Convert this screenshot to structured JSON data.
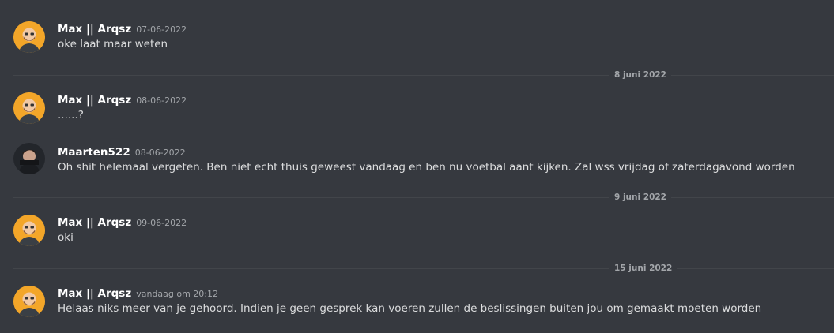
{
  "messages": [
    {
      "author": "Max || Arqsz",
      "timestamp": "07-06-2022",
      "text": "oke laat maar weten"
    },
    {
      "author": "Max || Arqsz",
      "timestamp": "08-06-2022",
      "text": "......?"
    },
    {
      "author": "Maarten522",
      "timestamp": "08-06-2022",
      "text": "Oh shit helemaal vergeten. Ben niet echt thuis geweest vandaag en ben nu voetbal aant kijken. Zal wss vrijdag of zaterdagavond worden"
    },
    {
      "author": "Max || Arqsz",
      "timestamp": "09-06-2022",
      "text": "oki"
    },
    {
      "author": "Max || Arqsz",
      "timestamp": "vandaag om 20:12",
      "text": "Helaas niks meer van je gehoord. Indien je geen gesprek kan voeren zullen de beslissingen buiten jou om gemaakt moeten worden"
    }
  ],
  "dividers": [
    "8 juni 2022",
    "9 juni 2022",
    "15 juni 2022"
  ],
  "colors": {
    "background": "#36393f",
    "text": "#dcddde",
    "username": "#ffffff",
    "timestamp": "#a3a6aa",
    "max_avatar": "#f3a629"
  }
}
